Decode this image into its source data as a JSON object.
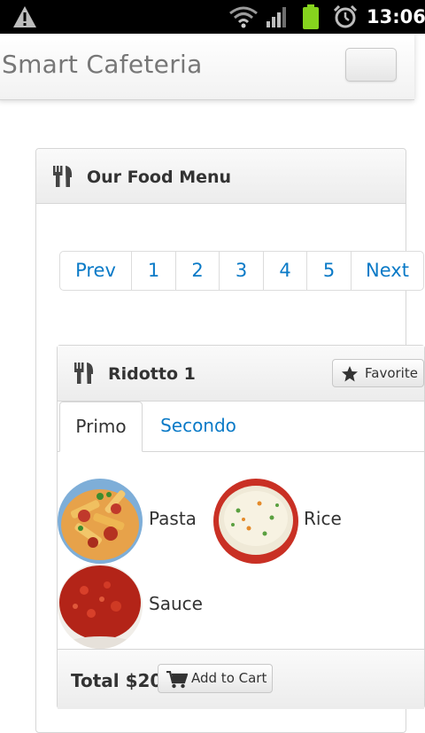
{
  "status_bar": {
    "time": "13:06",
    "icons": [
      "warning-icon",
      "wifi-icon",
      "signal-icon",
      "battery-icon",
      "alarm-icon"
    ]
  },
  "navbar": {
    "brand": "Smart Cafeteria",
    "toggle_icon": "menu-toggle"
  },
  "menu_panel": {
    "title": "Our Food Menu",
    "icon": "cutlery-icon"
  },
  "pagination": {
    "prev": "Prev",
    "pages": [
      "1",
      "2",
      "3",
      "4",
      "5"
    ],
    "next": "Next"
  },
  "product": {
    "title": "Ridotto 1",
    "icon": "cutlery-icon",
    "favorite_label": "Favorite",
    "tabs": [
      {
        "label": "Primo",
        "active": true
      },
      {
        "label": "Secondo",
        "active": false
      }
    ],
    "items": [
      {
        "name": "Pasta"
      },
      {
        "name": "Rice"
      },
      {
        "name": "Sauce"
      }
    ],
    "total": "Total $20",
    "add_to_cart_label": "Add to Cart"
  },
  "colors": {
    "link": "#0a7ac7",
    "text": "#333333",
    "brand_text": "#777777"
  }
}
